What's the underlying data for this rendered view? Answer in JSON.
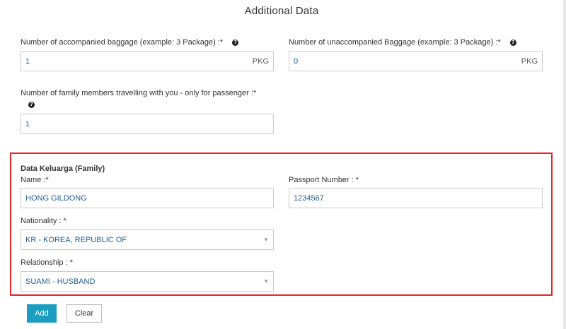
{
  "title": "Additional Data",
  "baggage": {
    "accompanied_label": "Number of accompanied baggage (example: 3 Package) :*",
    "accompanied_value": "1",
    "accompanied_unit": "PKG",
    "unaccompanied_label": "Number of unaccompanied Baggage (example: 3 Package) :*",
    "unaccompanied_value": "0",
    "unaccompanied_unit": "PKG"
  },
  "family_count": {
    "label": "Number of family members travelling with you - only for passenger :*",
    "value": "1"
  },
  "family": {
    "heading": "Data Keluarga (Family)",
    "name_label": "Name :*",
    "name_value": "HONG GILDONG",
    "passport_label": "Passport Number : *",
    "passport_value": "1234567",
    "nationality_label": "Nationality : *",
    "nationality_value": "KR - KOREA, REPUBLIC OF",
    "relationship_label": "Relationship : *",
    "relationship_value": "SUAMI - HUSBAND"
  },
  "buttons": {
    "add": "Add",
    "clear": "Clear"
  },
  "help_glyph": "?",
  "caret_glyph": "▼",
  "colors": {
    "accent": "#1b9ec1",
    "highlight_border": "#e32626",
    "value_text": "#1f5e99"
  }
}
